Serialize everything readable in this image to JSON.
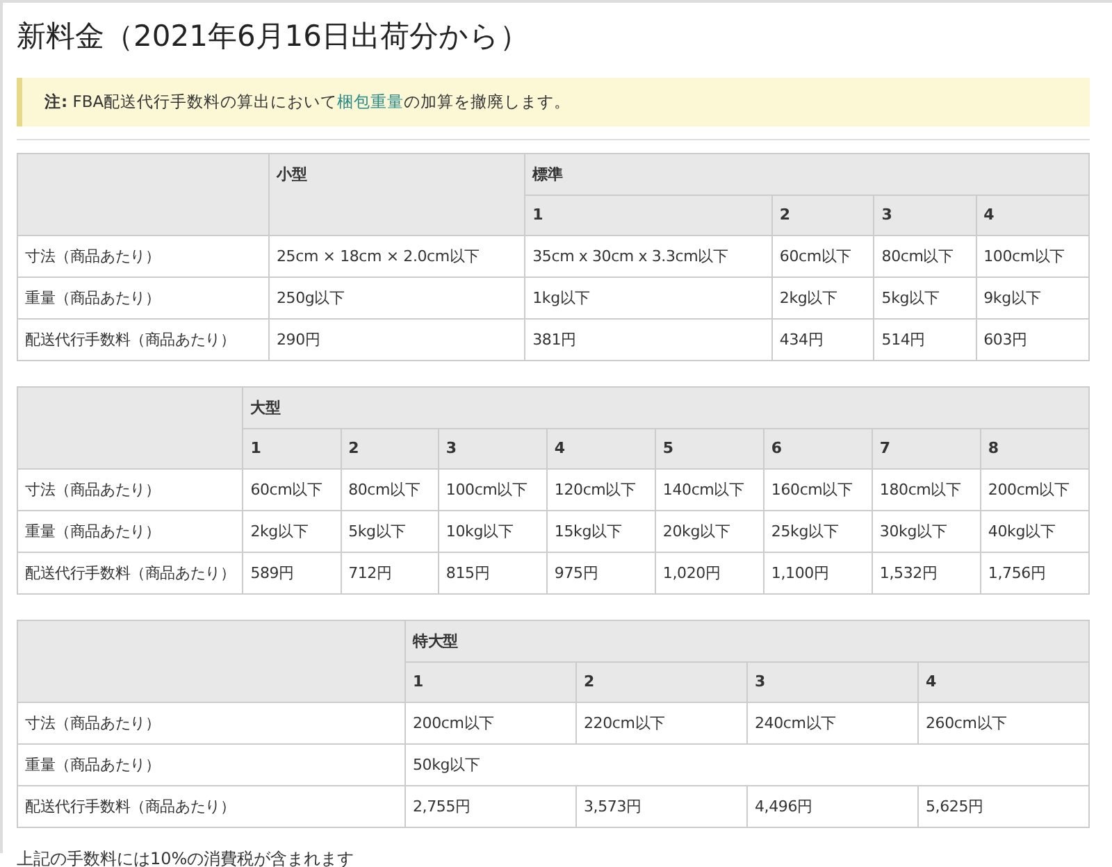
{
  "title": "新料金（2021年6月16日出荷分から）",
  "note": {
    "label": "注:",
    "before": " FBA配送代行手数料の算出において",
    "link": "梱包重量",
    "after": "の加算を撤廃します。"
  },
  "tables": [
    {
      "groups": [
        {
          "label": "小型"
        },
        {
          "label": "標準",
          "subcolumns": [
            "1",
            "2",
            "3",
            "4"
          ]
        }
      ],
      "rows": [
        {
          "label": "寸法（商品あたり）",
          "cells": [
            "25cm × 18cm × 2.0cm以下",
            "35cm x 30cm x 3.3cm以下",
            "60cm以下",
            "80cm以下",
            "100cm以下"
          ]
        },
        {
          "label": "重量（商品あたり）",
          "cells": [
            "250g以下",
            "1kg以下",
            "2kg以下",
            "5kg以下",
            "9kg以下"
          ]
        },
        {
          "label": "配送代行手数料（商品あたり）",
          "cells": [
            "290円",
            "381円",
            "434円",
            "514円",
            "603円"
          ]
        }
      ]
    },
    {
      "groups": [
        {
          "label": "大型",
          "subcolumns": [
            "1",
            "2",
            "3",
            "4",
            "5",
            "6",
            "7",
            "8"
          ]
        }
      ],
      "rows": [
        {
          "label": "寸法（商品あたり）",
          "cells": [
            "60cm以下",
            "80cm以下",
            "100cm以下",
            "120cm以下",
            "140cm以下",
            "160cm以下",
            "180cm以下",
            "200cm以下"
          ]
        },
        {
          "label": "重量（商品あたり）",
          "cells": [
            "2kg以下",
            "5kg以下",
            "10kg以下",
            "15kg以下",
            "20kg以下",
            "25kg以下",
            "30kg以下",
            "40kg以下"
          ]
        },
        {
          "label": "配送代行手数料（商品あたり）",
          "cells": [
            "589円",
            "712円",
            "815円",
            "975円",
            "1,020円",
            "1,100円",
            "1,532円",
            "1,756円"
          ]
        }
      ]
    },
    {
      "groups": [
        {
          "label": "特大型",
          "subcolumns": [
            "1",
            "2",
            "3",
            "4"
          ]
        }
      ],
      "rows": [
        {
          "label": "寸法（商品あたり）",
          "cells": [
            "200cm以下",
            "220cm以下",
            "240cm以下",
            "260cm以下"
          ]
        },
        {
          "label": "重量（商品あたり）",
          "cells": [
            {
              "text": "50kg以下",
              "colspan": 4
            }
          ]
        },
        {
          "label": "配送代行手数料（商品あたり）",
          "cells": [
            "2,755円",
            "3,573円",
            "4,496円",
            "5,625円"
          ]
        }
      ]
    }
  ],
  "footnote": "上記の手数料には10%の消費税が含まれます"
}
